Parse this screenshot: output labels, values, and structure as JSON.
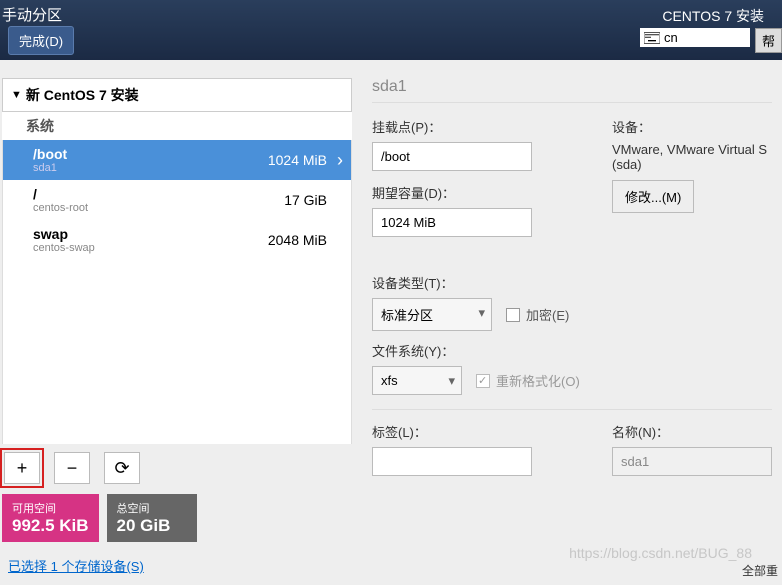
{
  "header": {
    "title": "手动分区",
    "done": "完成(D)",
    "installer": "CENTOS 7 安装",
    "lang": "cn",
    "help": "帮"
  },
  "tree": {
    "title": "新 CentOS 7 安装",
    "system": "系统"
  },
  "partitions": [
    {
      "mount": "/boot",
      "device": "sda1",
      "size": "1024 MiB",
      "selected": true
    },
    {
      "mount": "/",
      "device": "centos-root",
      "size": "17 GiB",
      "selected": false
    },
    {
      "mount": "swap",
      "device": "centos-swap",
      "size": "2048 MiB",
      "selected": false
    }
  ],
  "buttons": {
    "add": "+",
    "remove": "−",
    "refresh": "⟳"
  },
  "space": {
    "avail_label": "可用空间",
    "avail_value": "992.5 KiB",
    "total_label": "总空间",
    "total_value": "20 GiB"
  },
  "storage_link": "已选择 1 个存储设备(S)",
  "detail": {
    "title": "sda1",
    "mount_label": "挂载点(P)：",
    "mount_value": "/boot",
    "capacity_label": "期望容量(D)：",
    "capacity_value": "1024 MiB",
    "device_label": "设备：",
    "device_value": "VMware, VMware Virtual S (sda)",
    "modify": "修改...(M)",
    "type_label": "设备类型(T)：",
    "type_value": "标准分区",
    "encrypt": "加密(E)",
    "fs_label": "文件系统(Y)：",
    "fs_value": "xfs",
    "reformat": "重新格式化(O)",
    "tag_label": "标签(L)：",
    "tag_value": "",
    "name_label": "名称(N)：",
    "name_value": "sda1",
    "reset": "全部重"
  },
  "watermark": "https://blog.csdn.net/BUG_88"
}
